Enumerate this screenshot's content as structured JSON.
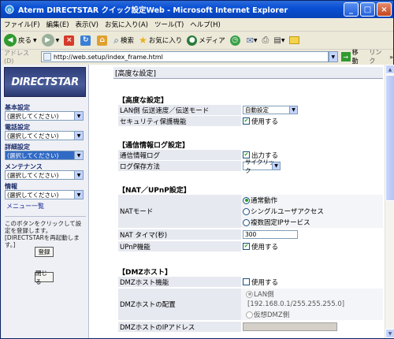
{
  "window": {
    "title": "Aterm DIRECTSTAR クイック設定Web - Microsoft Internet Explorer",
    "minimize": "_",
    "maximize": "□",
    "close": "×"
  },
  "menu": [
    "ファイル(F)",
    "編集(E)",
    "表示(V)",
    "お気に入り(A)",
    "ツール(T)",
    "ヘルプ(H)"
  ],
  "toolbar": {
    "back": "戻る",
    "search": "検索",
    "favorites": "お気に入り",
    "media": "メディア"
  },
  "address": {
    "label": "アドレス(D)",
    "url": "http://web.setup/index_frame.html",
    "go": "移動",
    "links": "リンク"
  },
  "sidebar": {
    "logo": "DIRECTSTAR",
    "groups": [
      {
        "label": "基本設定",
        "value": "(選択してください)"
      },
      {
        "label": "電話設定",
        "value": "(選択してください)"
      },
      {
        "label": "詳細設定",
        "value": "(選択してください)"
      },
      {
        "label": "メンテナンス",
        "value": "(選択してください)"
      },
      {
        "label": "情報",
        "value": "(選択してください)"
      }
    ],
    "menu_link": "メニュー一覧",
    "note": "このボタンをクリックして設定を登録します。[DIRECTSTARを再起動します。]",
    "register_button": "登録",
    "close_button": "閉じる"
  },
  "main": {
    "page_title": "[高度な設定]",
    "sections": {
      "advanced": {
        "title": "【高度な設定】",
        "lan_speed_label": "LAN側 伝送速度／伝送モード",
        "lan_speed_value": "自動設定",
        "security_label": "セキュリティ保護機能",
        "security_value": "使用する"
      },
      "log": {
        "title": "【通信情報ログ設定】",
        "log_label": "通信情報ログ",
        "log_value": "出力する",
        "save_label": "ログ保存方法",
        "save_value": "サイクリック"
      },
      "nat": {
        "title": "【NAT／UPnP設定】",
        "mode_label": "NATモード",
        "mode_options": [
          "通常動作",
          "シングルユーザアクセス",
          "複数固定IPサービス"
        ],
        "timer_label": "NAT タイマ(秒)",
        "timer_value": "300",
        "upnp_label": "UPnP機能",
        "upnp_value": "使用する"
      },
      "dmz": {
        "title": "【DMZホスト】",
        "func_label": "DMZホスト機能",
        "func_value": "使用する",
        "placement_label": "DMZホストの配置",
        "placement_lan": "LAN側",
        "placement_lan_range": "[192.168.0.1/255.255.255.0]",
        "placement_virtual": "仮想DMZ側",
        "ip_label": "DMZホストのIPアドレス",
        "ip_value": ""
      }
    }
  }
}
